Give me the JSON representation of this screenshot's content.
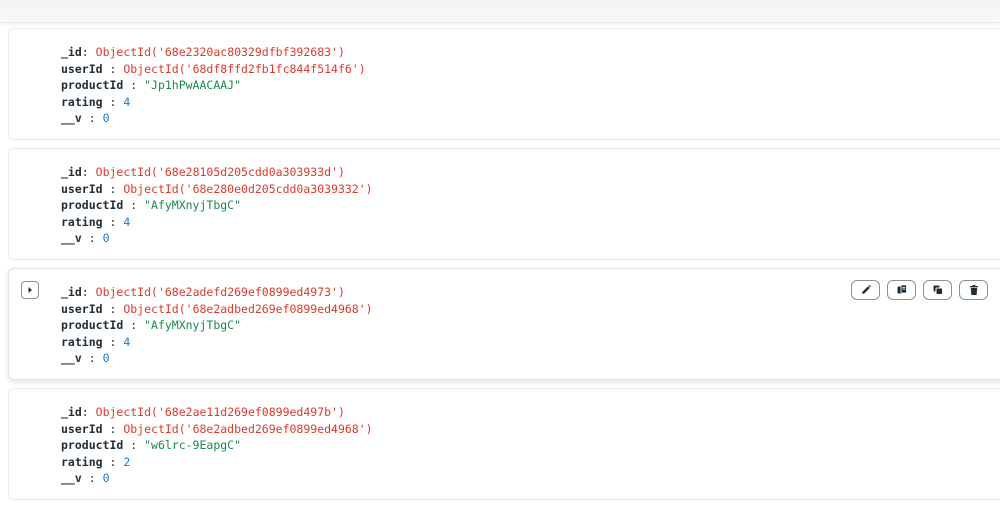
{
  "documents": [
    {
      "fields": [
        {
          "key": "_id",
          "sep": ": ",
          "value": "ObjectId('68e2320ac80329dfbf392683')",
          "type": "oid"
        },
        {
          "key": "userId",
          "sep": " : ",
          "value": "ObjectId('68df8ffd2fb1fc844f514f6')",
          "type": "oid"
        },
        {
          "key": "productId",
          "sep": " : ",
          "value": "\"Jp1hPwAACAAJ\"",
          "type": "str"
        },
        {
          "key": "rating",
          "sep": " : ",
          "value": "4",
          "type": "num"
        },
        {
          "key": "__v",
          "sep": " : ",
          "value": "0",
          "type": "num"
        }
      ]
    },
    {
      "fields": [
        {
          "key": "_id",
          "sep": ": ",
          "value": "ObjectId('68e28105d205cdd0a303933d')",
          "type": "oid"
        },
        {
          "key": "userId",
          "sep": " : ",
          "value": "ObjectId('68e280e0d205cdd0a3039332')",
          "type": "oid"
        },
        {
          "key": "productId",
          "sep": " : ",
          "value": "\"AfyMXnyjTbgC\"",
          "type": "str"
        },
        {
          "key": "rating",
          "sep": " : ",
          "value": "4",
          "type": "num"
        },
        {
          "key": "__v",
          "sep": " : ",
          "value": "0",
          "type": "num"
        }
      ]
    },
    {
      "fields": [
        {
          "key": "_id",
          "sep": ": ",
          "value": "ObjectId('68e2adefd269ef0899ed4973')",
          "type": "oid"
        },
        {
          "key": "userId",
          "sep": " : ",
          "value": "ObjectId('68e2adbed269ef0899ed4968')",
          "type": "oid"
        },
        {
          "key": "productId",
          "sep": " : ",
          "value": "\"AfyMXnyjTbgC\"",
          "type": "str"
        },
        {
          "key": "rating",
          "sep": " : ",
          "value": "4",
          "type": "num"
        },
        {
          "key": "__v",
          "sep": " : ",
          "value": "0",
          "type": "num"
        }
      ]
    },
    {
      "fields": [
        {
          "key": "_id",
          "sep": ": ",
          "value": "ObjectId('68e2ae11d269ef0899ed497b')",
          "type": "oid"
        },
        {
          "key": "userId",
          "sep": " : ",
          "value": "ObjectId('68e2adbed269ef0899ed4968')",
          "type": "oid"
        },
        {
          "key": "productId",
          "sep": " : ",
          "value": "\"w6lrc-9EapgC\"",
          "type": "str"
        },
        {
          "key": "rating",
          "sep": " : ",
          "value": "2",
          "type": "num"
        },
        {
          "key": "__v",
          "sep": " : ",
          "value": "0",
          "type": "num"
        }
      ]
    }
  ],
  "hovered_document_index": 2,
  "icons": {
    "expand": "caret-right-icon",
    "edit": "pencil-icon",
    "copy": "copy-icon",
    "clone": "clone-icon",
    "delete": "trash-icon"
  },
  "colors": {
    "key": "#1c2d38",
    "objectid": "#db3a2b",
    "string": "#1a8a4a",
    "number": "#1779d6",
    "border": "#e8ebeb"
  }
}
